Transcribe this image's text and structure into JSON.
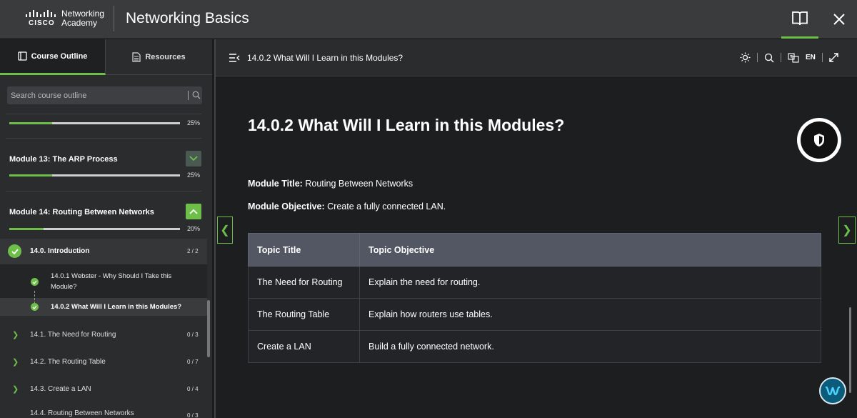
{
  "header": {
    "logo_text_line1": "Networking",
    "logo_text_line2": "Academy",
    "logo_brand": "CISCO",
    "app_title": "Networking Basics",
    "icons": [
      "book-icon",
      "close-icon"
    ]
  },
  "sidebar": {
    "tabs": [
      {
        "label": "Course Outline",
        "icon": "book-icon",
        "active": true
      },
      {
        "label": "Resources",
        "icon": "document-icon",
        "active": false
      }
    ],
    "search_placeholder": "Search course outline",
    "modules": [
      {
        "title": "",
        "progress_pct": 25,
        "progress_label": "25%"
      },
      {
        "title": "Module 13: The ARP Process",
        "progress_pct": 25,
        "progress_label": "25%",
        "expanded": false
      },
      {
        "title": "Module 14: Routing Between Networks",
        "progress_pct": 20,
        "progress_label": "20%",
        "expanded": true
      }
    ],
    "sections": [
      {
        "title": "14.0. Introduction",
        "count": "2 / 2",
        "complete": true
      },
      {
        "title": "14.1. The Need for Routing",
        "count": "0 / 3"
      },
      {
        "title": "14.2. The Routing Table",
        "count": "0 / 7"
      },
      {
        "title": "14.3. Create a LAN",
        "count": "0 / 4"
      },
      {
        "title": "14.4. Routing Between Networks",
        "count": "0 / 3"
      }
    ],
    "subtopics": [
      {
        "title_line1": "14.0.1 Webster - Why Should I Take this",
        "title_line2": "Module?",
        "complete": true
      },
      {
        "title": "14.0.2 What Will I Learn in this Modules?",
        "complete": true,
        "active": true
      }
    ]
  },
  "content": {
    "breadcrumb": "14.0.2 What Will I Learn in this Modules?",
    "language": "EN",
    "page_title": "14.0.2 What Will I Learn in this Modules?",
    "module_title_label": "Module Title:",
    "module_title_value": "Routing Between Networks",
    "module_objective_label": "Module Objective:",
    "module_objective_value": "Create a fully connected LAN.",
    "table": {
      "headers": [
        "Topic Title",
        "Topic Objective"
      ],
      "rows": [
        [
          "The Need for Routing",
          "Explain the need for routing."
        ],
        [
          "The Routing Table",
          "Explain how routers use tables."
        ],
        [
          "Create a LAN",
          "Build a fully connected network."
        ]
      ]
    }
  },
  "colors": {
    "accent": "#6ebe4a",
    "header_bg": "#3a3b3d",
    "table_header": "#525763"
  }
}
